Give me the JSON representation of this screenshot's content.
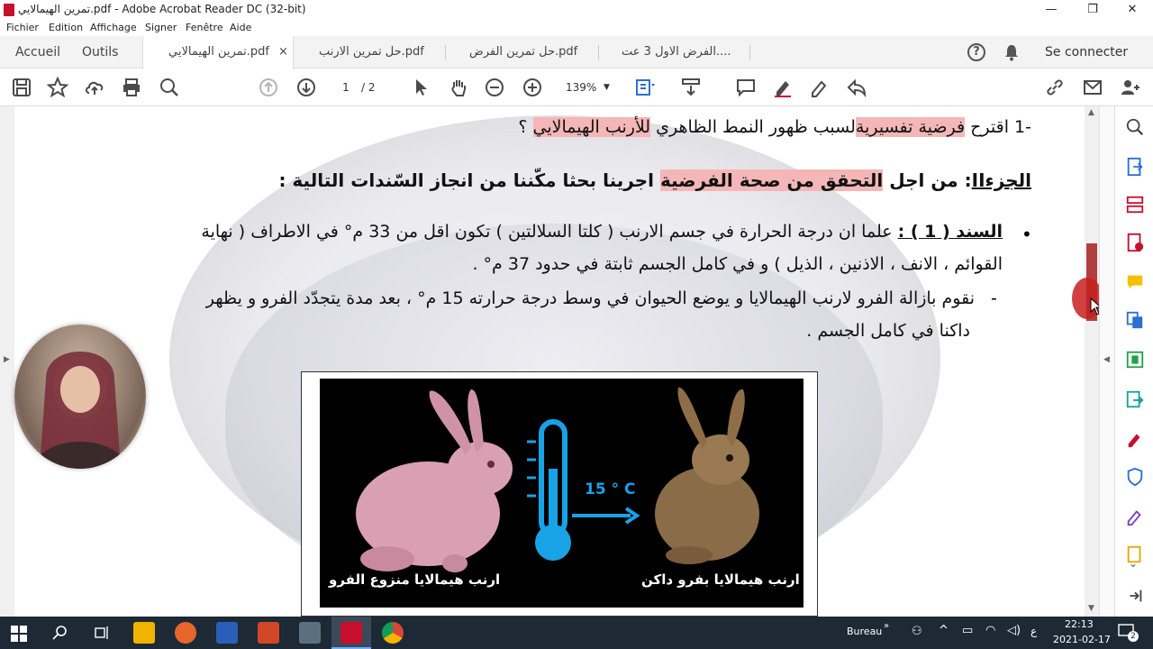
{
  "window": {
    "title": "تمرين الهيمالايي.pdf - Adobe Acrobat Reader DC (32-bit)",
    "minimize": "—",
    "restore": "❐",
    "close": "✕"
  },
  "menu": [
    "Fichier",
    "Edition",
    "Affichage",
    "Signer",
    "Fenêtre",
    "Aide"
  ],
  "tabs": {
    "home": "Accueil",
    "tools": "Outils",
    "documents": [
      {
        "label": "تمرين الهيمالايي.pdf",
        "active": true,
        "close": "×"
      },
      {
        "label": "حل تمرين الارنب.pdf",
        "active": false
      },
      {
        "label": "حل تمرين الفرض.pdf",
        "active": false
      },
      {
        "label": "الفرض الاول 3 عت....",
        "active": false
      }
    ],
    "signin": "Se connecter"
  },
  "toolbar": {
    "page_current": "1",
    "page_total": "/ 2",
    "zoom": "139%"
  },
  "document": {
    "q1_number": "-1",
    "q1_a": "اقترح ",
    "q1_b": "فرضية تفسيرية",
    "q1_c": "لسبب ظهور النمط الظاهري ",
    "q1_d": "للأرنب الهيمالايي",
    "q1_e": "  ؟",
    "part2_a": "الجزء",
    "part2_b": "II",
    "part2_c": ":  من اجل ",
    "part2_d": "التحقق من صحة الفرضية",
    "part2_e": " اجرينا بحثا مكّننا من انجاز السّندات التالية  :",
    "bullet": "•",
    "doc1_label": "السند ( 1 )  :",
    "doc1_line1": " علما ان درجة الحرارة في جسم الارنب ( كلتا السلالتين ) تكون اقل من 33 م° في الاطراف ( نهاية",
    "doc1_line2": "القوائم ، الانف ، الاذنين ، الذيل ) و في كامل الجسم ثابتة في حدود 37 م° .",
    "doc1_dash": "-",
    "doc1_line3": "نقوم بازالة الفرو لارنب الهيمالايا و يوضع الحيوان في وسط درجة حرارته 15 م° ، بعد مدة يتجدّد الفرو و يظهر",
    "doc1_line4": "داكنا في كامل الجسم ."
  },
  "figure": {
    "temperature": "15 ° C",
    "caption_left": "ارنب هيمالايا منزوع الفرو",
    "caption_right": "ارنب هيمالايا بفرو داكن"
  },
  "taskbar": {
    "bureau": "Bureau",
    "lang": "ع",
    "time": "22:13",
    "date": "2021-02-17",
    "notif_count": "2"
  }
}
